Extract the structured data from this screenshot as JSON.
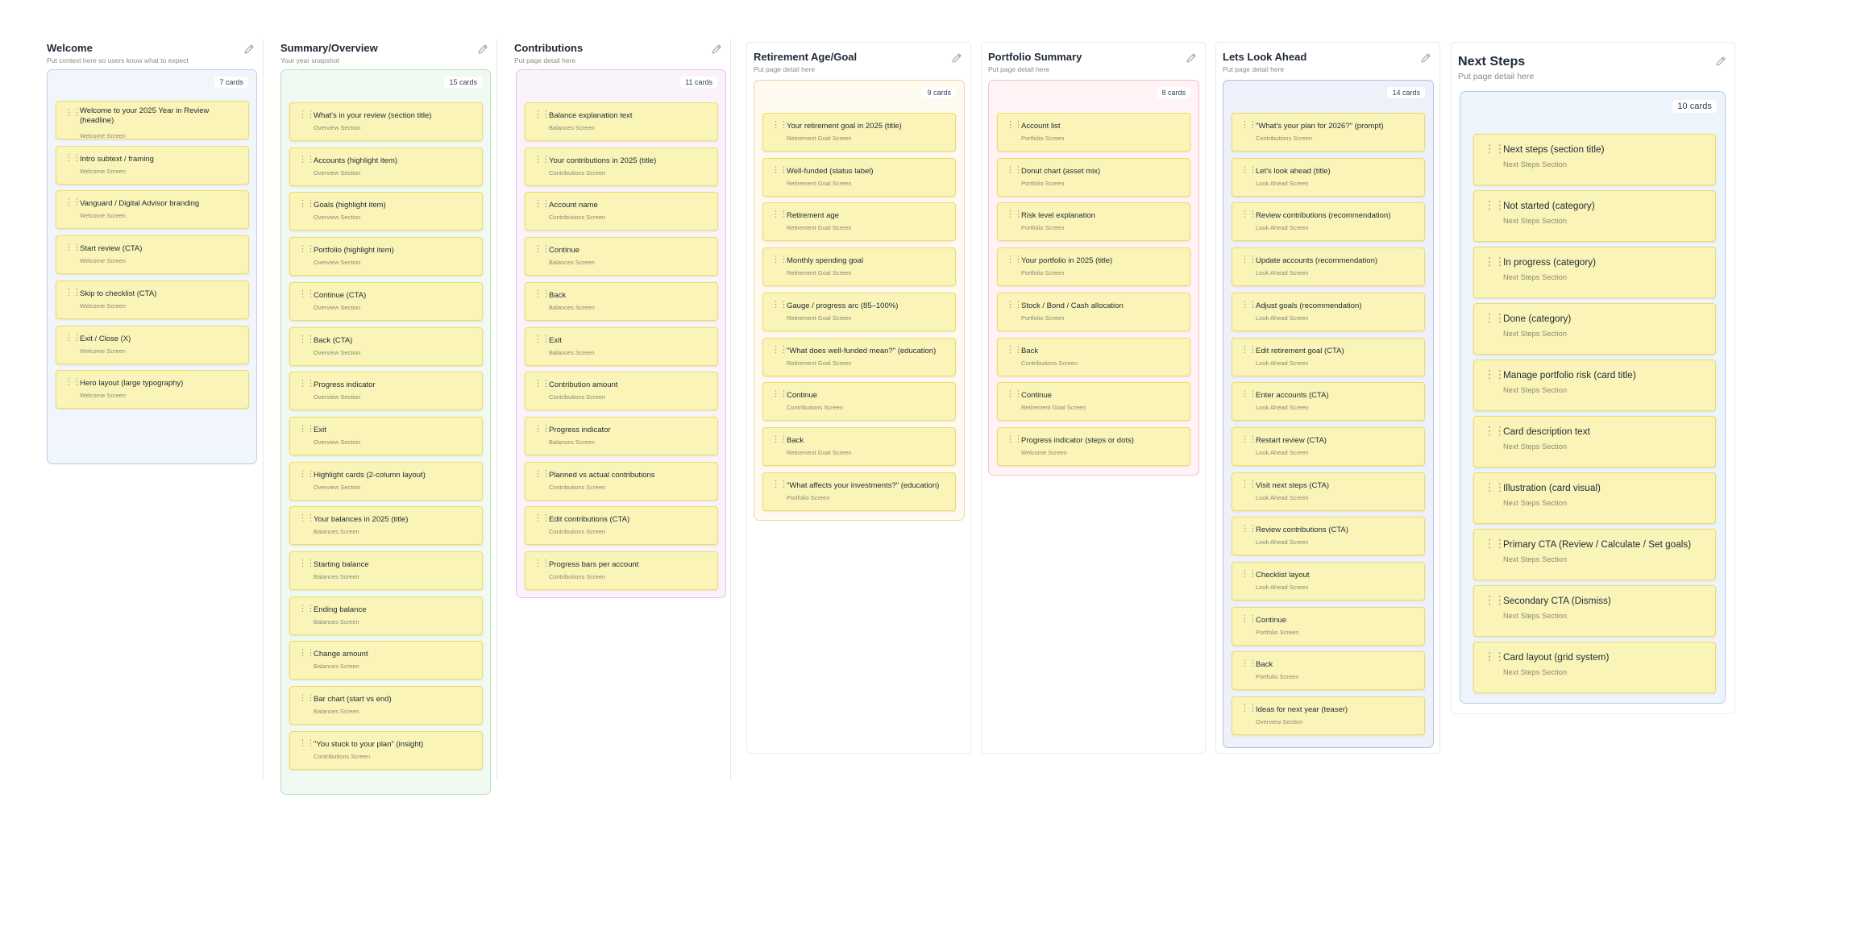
{
  "icons": {
    "edit": "pencil-icon",
    "drag": "drag-handle-icon"
  },
  "colors": {
    "card_bg": "#fbf4b8",
    "card_border": "#eedc6a",
    "lanes": {
      "welcome": {
        "bg": "#f1f6fc",
        "border": "#b8cceb"
      },
      "summary": {
        "bg": "#f0f9f2",
        "border": "#b6e0c0"
      },
      "contributions": {
        "bg": "#faf3fb",
        "border": "#e4c4ec"
      },
      "retirement": {
        "bg": "#fffaf0",
        "border": "#f2d3a2"
      },
      "portfolio": {
        "bg": "#fff3f6",
        "border": "#f4c0cc"
      },
      "lookahead": {
        "bg": "#eef1fa",
        "border": "#b4bfe4"
      },
      "nextsteps": {
        "bg": "#eef4fc",
        "border": "#b8cdee"
      }
    }
  },
  "columns": [
    {
      "title": "Welcome",
      "subtitle": "Put context here so users know what to expect",
      "count": "7 cards",
      "cards": [
        {
          "title": "Welcome to your 2025 Year in Review (headline)",
          "tag": "Welcome Screen"
        },
        {
          "title": "Intro subtext / framing",
          "tag": "Welcome Screen"
        },
        {
          "title": "Vanguard / Digital Advisor branding",
          "tag": "Welcome Screen"
        },
        {
          "title": "Start review (CTA)",
          "tag": "Welcome Screen"
        },
        {
          "title": "Skip to checklist (CTA)",
          "tag": "Welcome Screen"
        },
        {
          "title": "Exit / Close (X)",
          "tag": "Welcome Screen"
        },
        {
          "title": "Hero layout (large typography)",
          "tag": "Welcome Screen"
        }
      ]
    },
    {
      "title": "Summary/Overview",
      "subtitle": "Your year snapshot",
      "count": "15 cards",
      "cards": [
        {
          "title": "What's in your review (section title)",
          "tag": "Overview Section"
        },
        {
          "title": "Accounts (highlight item)",
          "tag": "Overview Section"
        },
        {
          "title": "Goals (highlight item)",
          "tag": "Overview Section"
        },
        {
          "title": "Portfolio (highlight item)",
          "tag": "Overview Section"
        },
        {
          "title": "Continue (CTA)",
          "tag": "Overview Section"
        },
        {
          "title": "Back (CTA)",
          "tag": "Overview Section"
        },
        {
          "title": "Progress indicator",
          "tag": "Overview Section"
        },
        {
          "title": "Exit",
          "tag": "Overview Section"
        },
        {
          "title": "Highlight cards (2-column layout)",
          "tag": "Overview Section"
        },
        {
          "title": "Your balances in 2025 (title)",
          "tag": "Balances Screen"
        },
        {
          "title": "Starting balance",
          "tag": "Balances Screen"
        },
        {
          "title": "Ending balance",
          "tag": "Balances Screen"
        },
        {
          "title": "Change amount",
          "tag": "Balances Screen"
        },
        {
          "title": "Bar chart (start vs end)",
          "tag": "Balances Screen"
        },
        {
          "title": "\"You stuck to your plan\" (insight)",
          "tag": "Contributions Screen"
        }
      ]
    },
    {
      "title": "Contributions",
      "subtitle": "Put page detail here",
      "count": "11 cards",
      "cards": [
        {
          "title": "Balance explanation text",
          "tag": "Balances Screen"
        },
        {
          "title": "Your contributions in 2025 (title)",
          "tag": "Contributions Screen"
        },
        {
          "title": "Account name",
          "tag": "Contributions Screen"
        },
        {
          "title": "Continue",
          "tag": "Balances Screen"
        },
        {
          "title": "Back",
          "tag": "Balances Screen"
        },
        {
          "title": "Exit",
          "tag": "Balances Screen"
        },
        {
          "title": "Contribution amount",
          "tag": "Contributions Screen"
        },
        {
          "title": "Progress indicator",
          "tag": "Balances Screen"
        },
        {
          "title": "Planned vs actual contributions",
          "tag": "Contributions Screen"
        },
        {
          "title": "Edit contributions (CTA)",
          "tag": "Contributions Screen"
        },
        {
          "title": "Progress bars per account",
          "tag": "Contributions Screen"
        }
      ]
    },
    {
      "title": "Retirement Age/Goal",
      "subtitle": "Put page detail here",
      "count": "9 cards",
      "cards": [
        {
          "title": "Your retirement goal in 2025 (title)",
          "tag": "Retirement Goal Screen"
        },
        {
          "title": "Well-funded (status label)",
          "tag": "Retirement Goal Screen"
        },
        {
          "title": "Retirement age",
          "tag": "Retirement Goal Screen"
        },
        {
          "title": "Monthly spending goal",
          "tag": "Retirement Goal Screen"
        },
        {
          "title": "Gauge / progress arc (85–100%)",
          "tag": "Retirement Goal Screen"
        },
        {
          "title": "\"What does well-funded mean?\" (education)",
          "tag": "Retirement Goal Screen"
        },
        {
          "title": "Continue",
          "tag": "Contributions Screen"
        },
        {
          "title": "Back",
          "tag": "Retirement Goal Screen"
        },
        {
          "title": "\"What affects your investments?\" (education)",
          "tag": "Portfolio Screen"
        }
      ]
    },
    {
      "title": "Portfolio Summary",
      "subtitle": "Put page detail here",
      "count": "8 cards",
      "cards": [
        {
          "title": "Account list",
          "tag": "Portfolio Screen"
        },
        {
          "title": "Donut chart (asset mix)",
          "tag": "Portfolio Screen"
        },
        {
          "title": "Risk level explanation",
          "tag": "Portfolio Screen"
        },
        {
          "title": "Your portfolio in 2025 (title)",
          "tag": "Portfolio Screen"
        },
        {
          "title": "Stock / Bond / Cash allocation",
          "tag": "Portfolio Screen"
        },
        {
          "title": "Back",
          "tag": "Contributions Screen"
        },
        {
          "title": "Continue",
          "tag": "Retirement Goal Screen"
        },
        {
          "title": "Progress indicator (steps or dots)",
          "tag": "Welcome Screen"
        }
      ]
    },
    {
      "title": "Lets Look Ahead",
      "subtitle": "Put page detail here",
      "count": "14 cards",
      "cards": [
        {
          "title": "\"What's your plan for 2026?\" (prompt)",
          "tag": "Contributions Screen"
        },
        {
          "title": "Let's look ahead (title)",
          "tag": "Look Ahead Screen"
        },
        {
          "title": "Review contributions (recommendation)",
          "tag": "Look Ahead Screen"
        },
        {
          "title": "Update accounts (recommendation)",
          "tag": "Look Ahead Screen"
        },
        {
          "title": "Adjust goals (recommendation)",
          "tag": "Look Ahead Screen"
        },
        {
          "title": "Edit retirement goal (CTA)",
          "tag": "Look Ahead Screen"
        },
        {
          "title": "Enter accounts (CTA)",
          "tag": "Look Ahead Screen"
        },
        {
          "title": "Restart review (CTA)",
          "tag": "Look Ahead Screen"
        },
        {
          "title": "Visit next steps (CTA)",
          "tag": "Look Ahead Screen"
        },
        {
          "title": "Review contributions (CTA)",
          "tag": "Look Ahead Screen"
        },
        {
          "title": "Checklist layout",
          "tag": "Look Ahead Screen"
        },
        {
          "title": "Continue",
          "tag": "Portfolio Screen"
        },
        {
          "title": "Back",
          "tag": "Portfolio Screen"
        },
        {
          "title": "Ideas for next year (teaser)",
          "tag": "Overview Section"
        }
      ]
    },
    {
      "title": "Next Steps",
      "subtitle": "Put page detail here",
      "count": "10 cards",
      "cards": [
        {
          "title": "Next steps (section title)",
          "tag": "Next Steps Section"
        },
        {
          "title": "Not started (category)",
          "tag": "Next Steps Section"
        },
        {
          "title": "In progress (category)",
          "tag": "Next Steps Section"
        },
        {
          "title": "Done (category)",
          "tag": "Next Steps Section"
        },
        {
          "title": "Manage portfolio risk (card title)",
          "tag": "Next Steps Section"
        },
        {
          "title": "Card description text",
          "tag": "Next Steps Section"
        },
        {
          "title": "Illustration (card visual)",
          "tag": "Next Steps Section"
        },
        {
          "title": "Primary CTA (Review / Calculate / Set goals)",
          "tag": "Next Steps Section"
        },
        {
          "title": "Secondary CTA (Dismiss)",
          "tag": "Next Steps Section"
        },
        {
          "title": "Card layout (grid system)",
          "tag": "Next Steps Section"
        }
      ]
    }
  ]
}
